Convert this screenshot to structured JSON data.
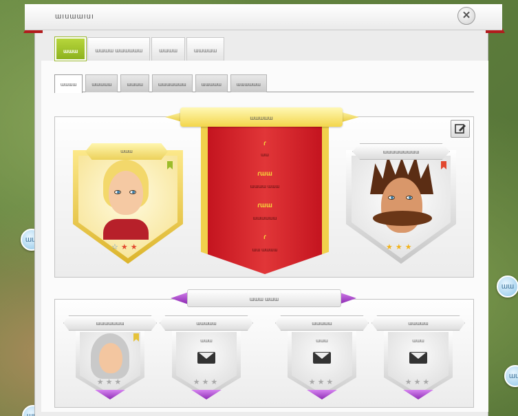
{
  "window": {
    "title": "ɯıuɯɯıuı",
    "close_symbol": "✕"
  },
  "main_tabs": [
    {
      "label": "ɯɯɯ",
      "active": true
    },
    {
      "label": "ɯɯɯɯ ɯɯɯɯɯɯ",
      "active": false
    },
    {
      "label": "ɯɯɯɯ",
      "active": false
    },
    {
      "label": "ɯɯɯɯɯ",
      "active": false
    }
  ],
  "sub_tabs": [
    {
      "label": "ɯɯɯɯ",
      "active": true
    },
    {
      "label": "ɯɯɯɯɯ",
      "active": false
    },
    {
      "label": "ɯɯɯɯ",
      "active": false
    },
    {
      "label": "ɯɯɯɯɯɯɯ",
      "active": false
    },
    {
      "label": "ɯɯɯɯɯ",
      "active": false
    },
    {
      "label": "ɯɯɯɯɯɯ",
      "active": false
    }
  ],
  "center_banner": {
    "title": "ɯɯɯɯɯ",
    "lines": [
      {
        "text": "ɾ",
        "gold": true
      },
      {
        "text": "ɯɯ",
        "gold": false
      },
      {
        "text": "ɾɯɯ",
        "gold": true
      },
      {
        "text": "ɯɯɯɯ ɯɯɯ",
        "gold": false
      },
      {
        "text": "ɾɯɯ",
        "gold": true
      },
      {
        "text": "ɯɯɯɯɯɯ",
        "gold": false
      },
      {
        "text": "ɾ",
        "gold": true
      },
      {
        "text": "ɯɯ ɯɯɯɯ",
        "gold": false
      }
    ]
  },
  "left_portrait": {
    "name": "ɯɯɯ",
    "stars": [
      "☆",
      "★",
      "★"
    ]
  },
  "right_portrait": {
    "name": "ɯɯɯɯɯɯɯɯɯ",
    "stars": [
      "★",
      "★",
      "★"
    ]
  },
  "bottom_banner": {
    "title": "ɯɯɯ ɯɯɯ"
  },
  "slots": [
    {
      "name": "ɯɯɯɯɯɯɯ",
      "sub": "",
      "has_avatar": true,
      "stars": "★★★"
    },
    {
      "name": "ɯɯɯɯɯ",
      "sub": "ɯɯɯ",
      "has_avatar": false,
      "stars": "★★★"
    },
    {
      "name": "ɯɯɯɯɯ",
      "sub": "ɯɯɯ",
      "has_avatar": false,
      "stars": "★★★"
    },
    {
      "name": "ɯɯɯɯɯ",
      "sub": "ɯɯɯ",
      "has_avatar": false,
      "stars": "★★★"
    }
  ],
  "side_bubbles": [
    "ɯɯ",
    "ɯɯ",
    "ɯɯ",
    "ɯɯ"
  ],
  "icons": {
    "edit": "edit-icon",
    "mail": "mail-icon",
    "bookmark": "bookmark-icon",
    "close": "close-icon"
  },
  "colors": {
    "accent_green": "#8db21e",
    "ribbon_red": "#c4141f",
    "gold": "#f3d64b",
    "purple": "#8a27b0"
  }
}
